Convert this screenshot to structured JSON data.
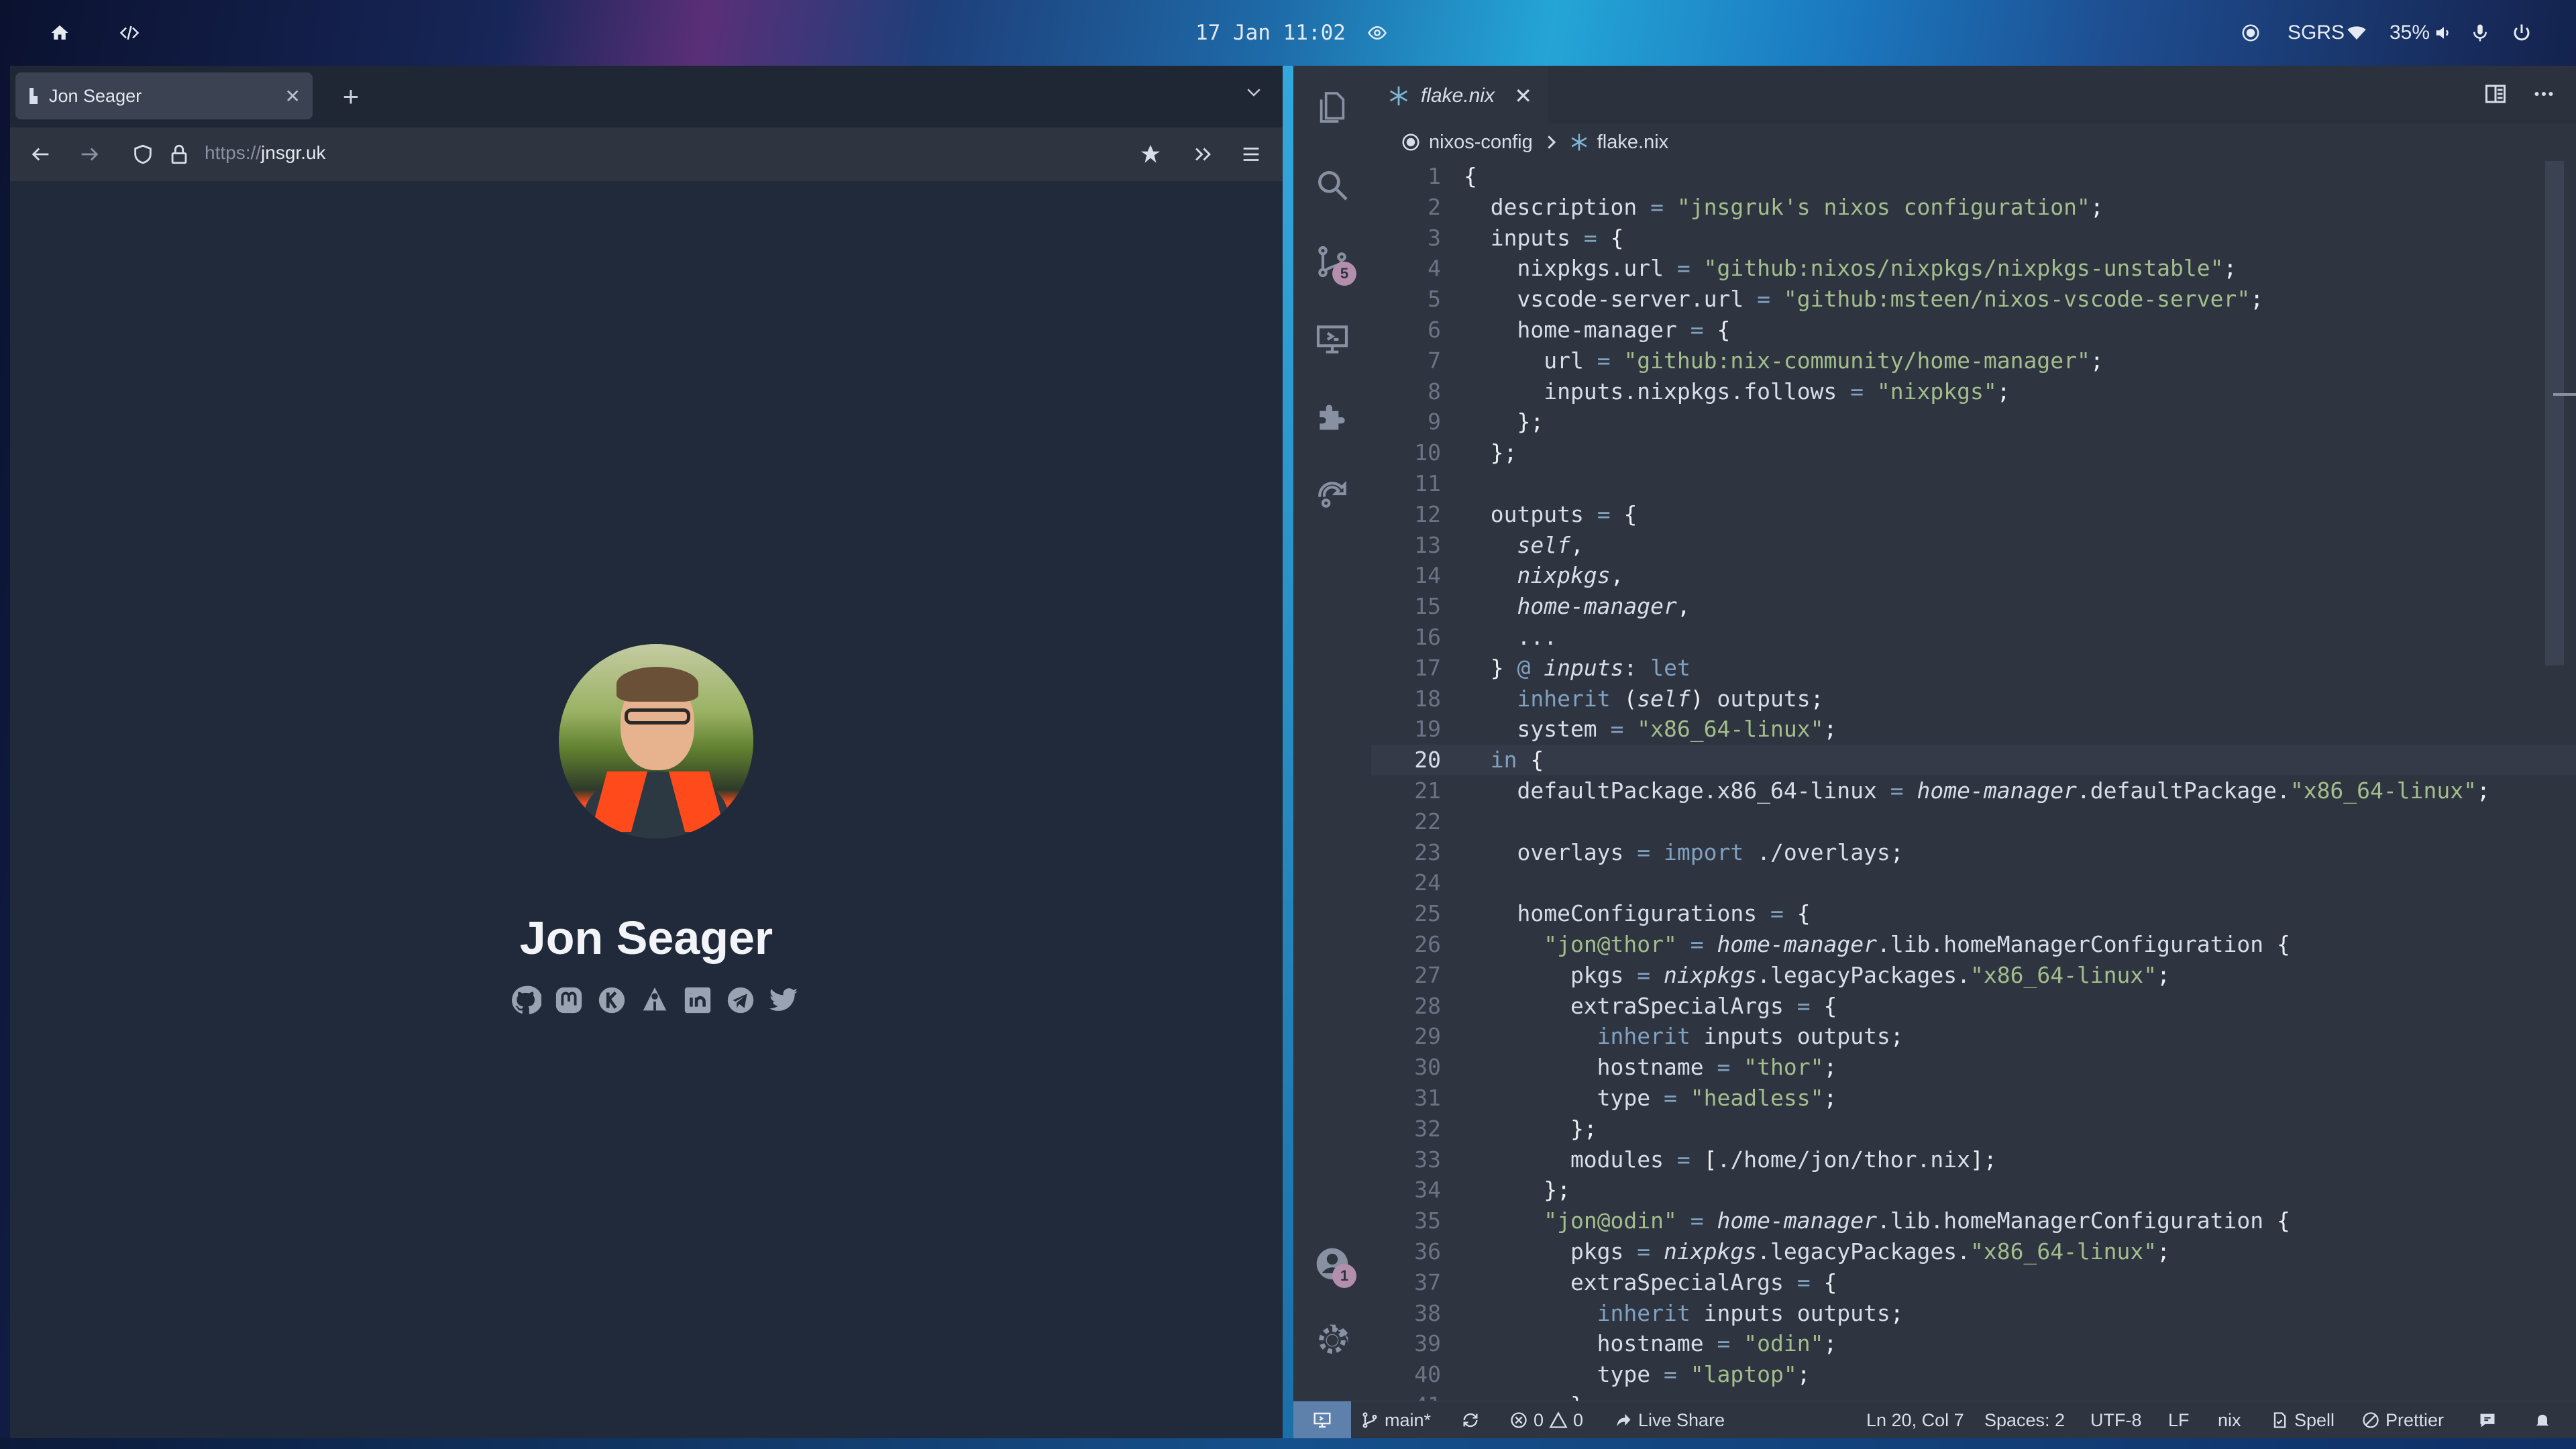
{
  "topbar": {
    "clock": "17 Jan 11:02",
    "network": "SGRS",
    "battery": "35%",
    "icons": [
      "home-icon",
      "code-icon",
      "eye-icon",
      "circle-dot-icon",
      "wifi-icon",
      "volume-icon",
      "microphone-icon",
      "power-icon"
    ]
  },
  "browser": {
    "tab_title": "Jon Seager",
    "url_scheme": "https://",
    "url_host": "jnsgr.uk",
    "page": {
      "name": "Jon Seager",
      "social_icons": [
        "github-icon",
        "mastodon-icon",
        "keybase-icon",
        "launchpad-icon",
        "linkedin-icon",
        "telegram-icon",
        "twitter-icon"
      ]
    }
  },
  "editor": {
    "tab_label": "flake.nix",
    "breadcrumb": [
      "nixos-config",
      "flake.nix"
    ],
    "scm_badge": "5",
    "accounts_badge": "1",
    "current_line": 20,
    "lines": [
      "{",
      "  description = \"jnsgruk's nixos configuration\";",
      "  inputs = {",
      "    nixpkgs.url = \"github:nixos/nixpkgs/nixpkgs-unstable\";",
      "    vscode-server.url = \"github:msteen/nixos-vscode-server\";",
      "    home-manager = {",
      "      url = \"github:nix-community/home-manager\";",
      "      inputs.nixpkgs.follows = \"nixpkgs\";",
      "    };",
      "  };",
      "",
      "  outputs = {",
      "    self,",
      "    nixpkgs,",
      "    home-manager,",
      "    ...",
      "  } @ inputs: let",
      "    inherit (self) outputs;",
      "    system = \"x86_64-linux\";",
      "  in {",
      "    defaultPackage.x86_64-linux = home-manager.defaultPackage.\"x86_64-linux\";",
      "",
      "    overlays = import ./overlays;",
      "",
      "    homeConfigurations = {",
      "      \"jon@thor\" = home-manager.lib.homeManagerConfiguration {",
      "        pkgs = nixpkgs.legacyPackages.\"x86_64-linux\";",
      "        extraSpecialArgs = {",
      "          inherit inputs outputs;",
      "          hostname = \"thor\";",
      "          type = \"headless\";",
      "        };",
      "        modules = [./home/jon/thor.nix];",
      "      };",
      "      \"jon@odin\" = home-manager.lib.homeManagerConfiguration {",
      "        pkgs = nixpkgs.legacyPackages.\"x86_64-linux\";",
      "        extraSpecialArgs = {",
      "          inherit inputs outputs;",
      "          hostname = \"odin\";",
      "          type = \"laptop\";",
      "        };"
    ]
  },
  "statusbar": {
    "branch": "main*",
    "errors": "0",
    "warnings": "0",
    "live_share": "Live Share",
    "position": "Ln 20, Col 7",
    "spaces": "Spaces: 2",
    "encoding": "UTF-8",
    "eol": "LF",
    "language": "nix",
    "spell": "Spell",
    "prettier": "Prettier"
  },
  "colors": {
    "accent": "#5e81ac",
    "badge": "#b48ead",
    "editor_bg": "#2e3440",
    "string": "#a3be8c",
    "keyword": "#81a1c1"
  }
}
